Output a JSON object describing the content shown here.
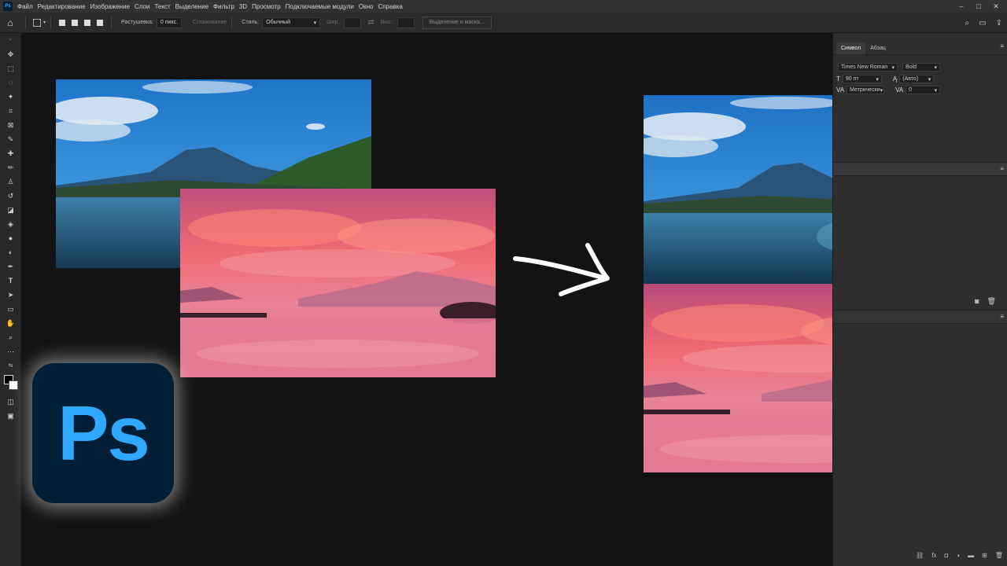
{
  "menu": {
    "items": [
      "Файл",
      "Редактирование",
      "Изображение",
      "Слои",
      "Текст",
      "Выделение",
      "Фильтр",
      "3D",
      "Просмотр",
      "Подключаемые модули",
      "Окно",
      "Справка"
    ],
    "app_icon": "Ps"
  },
  "options": {
    "feather_label": "Растушевка:",
    "feather_value": "0 пикс.",
    "antialias_label": "Сглаживание",
    "style_label": "Стиль:",
    "style_value": "Обычный",
    "width_label": "Шир.:",
    "height_label": "Выс.:",
    "select_mask_label": "Выделение и маска..."
  },
  "panel": {
    "tab_character": "Символ",
    "tab_paragraph": "Абзац",
    "font_family": "Times New Roman",
    "font_style": "Bold",
    "font_size": "90 пт",
    "leading": "(Авто)",
    "kerning": "Метрически",
    "tracking": "0"
  },
  "logo_text": "Ps",
  "colors": {
    "accent": "#31a8ff",
    "logo_bg": "#001e36",
    "canvas_bg": "#131313"
  }
}
